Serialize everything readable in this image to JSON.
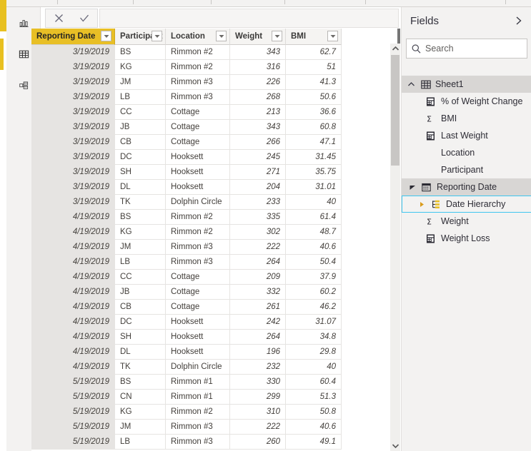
{
  "app": {
    "accent_gold": "#e8bf26",
    "focus_cyan": "#3ec6f0",
    "filler_gray": "#757575"
  },
  "rail": {
    "items": [
      {
        "name": "report-view",
        "icon": "bar-chart-icon",
        "selected": false
      },
      {
        "name": "data-view",
        "icon": "table-icon",
        "selected": true
      },
      {
        "name": "model-view",
        "icon": "relationships-icon",
        "selected": false
      }
    ]
  },
  "formula_bar": {
    "cancel_label": "✕",
    "accept_label": "✓",
    "value": "",
    "placeholder": ""
  },
  "grid": {
    "columns": [
      {
        "label": "Reporting Date",
        "align": "right",
        "selected": true,
        "has_filter": true
      },
      {
        "label": "Participant",
        "align": "left",
        "selected": false,
        "has_filter": true
      },
      {
        "label": "Location",
        "align": "left",
        "selected": false,
        "has_filter": true
      },
      {
        "label": "Weight",
        "align": "right",
        "selected": false,
        "has_filter": true
      },
      {
        "label": "BMI",
        "align": "right",
        "selected": false,
        "has_filter": true
      }
    ],
    "rows": [
      [
        "3/19/2019",
        "BS",
        "Rimmon #2",
        "343",
        "62.7"
      ],
      [
        "3/19/2019",
        "KG",
        "Rimmon #2",
        "316",
        "51"
      ],
      [
        "3/19/2019",
        "JM",
        "Rimmon #3",
        "226",
        "41.3"
      ],
      [
        "3/19/2019",
        "LB",
        "Rimmon #3",
        "268",
        "50.6"
      ],
      [
        "3/19/2019",
        "CC",
        "Cottage",
        "213",
        "36.6"
      ],
      [
        "3/19/2019",
        "JB",
        "Cottage",
        "343",
        "60.8"
      ],
      [
        "3/19/2019",
        "CB",
        "Cottage",
        "266",
        "47.1"
      ],
      [
        "3/19/2019",
        "DC",
        "Hooksett",
        "245",
        "31.45"
      ],
      [
        "3/19/2019",
        "SH",
        "Hooksett",
        "271",
        "35.75"
      ],
      [
        "3/19/2019",
        "DL",
        "Hooksett",
        "204",
        "31.01"
      ],
      [
        "3/19/2019",
        "TK",
        "Dolphin Circle",
        "233",
        "40"
      ],
      [
        "4/19/2019",
        "BS",
        "Rimmon #2",
        "335",
        "61.4"
      ],
      [
        "4/19/2019",
        "KG",
        "Rimmon #2",
        "302",
        "48.7"
      ],
      [
        "4/19/2019",
        "JM",
        "Rimmon #3",
        "222",
        "40.6"
      ],
      [
        "4/19/2019",
        "LB",
        "Rimmon #3",
        "264",
        "50.4"
      ],
      [
        "4/19/2019",
        "CC",
        "Cottage",
        "209",
        "37.9"
      ],
      [
        "4/19/2019",
        "JB",
        "Cottage",
        "332",
        "60.2"
      ],
      [
        "4/19/2019",
        "CB",
        "Cottage",
        "261",
        "46.2"
      ],
      [
        "4/19/2019",
        "DC",
        "Hooksett",
        "242",
        "31.07"
      ],
      [
        "4/19/2019",
        "SH",
        "Hooksett",
        "264",
        "34.8"
      ],
      [
        "4/19/2019",
        "DL",
        "Hooksett",
        "196",
        "29.8"
      ],
      [
        "4/19/2019",
        "TK",
        "Dolphin Circle",
        "232",
        "40"
      ],
      [
        "5/19/2019",
        "BS",
        "Rimmon #1",
        "330",
        "60.4"
      ],
      [
        "5/19/2019",
        "CN",
        "Rimmon #1",
        "299",
        "51.3"
      ],
      [
        "5/19/2019",
        "KG",
        "Rimmon #2",
        "310",
        "50.8"
      ],
      [
        "5/19/2019",
        "JM",
        "Rimmon #3",
        "222",
        "40.6"
      ],
      [
        "5/19/2019",
        "LB",
        "Rimmon #3",
        "260",
        "49.1"
      ]
    ]
  },
  "fields": {
    "title": "Fields",
    "collapse_icon": "chevron-right-icon",
    "search": {
      "placeholder": "Search",
      "value": "",
      "icon": "search-icon"
    },
    "table": {
      "name": "Sheet1",
      "expanded": true,
      "icon": "table-icon"
    },
    "items": [
      {
        "label": "% of Weight Change",
        "icon": "measure-icon",
        "indent": 1,
        "selected": false,
        "expandable": false
      },
      {
        "label": "BMI",
        "icon": "sigma-icon",
        "indent": 1,
        "selected": false,
        "expandable": false
      },
      {
        "label": "Last Weight",
        "icon": "measure-icon",
        "indent": 1,
        "selected": false,
        "expandable": false
      },
      {
        "label": "Location",
        "icon": "none",
        "indent": 1,
        "selected": false,
        "expandable": false
      },
      {
        "label": "Participant",
        "icon": "none",
        "indent": 1,
        "selected": false,
        "expandable": false
      },
      {
        "label": "Reporting Date",
        "icon": "calendar-icon",
        "indent": 1,
        "selected": true,
        "expandable": true,
        "expanded": true
      },
      {
        "label": "Date Hierarchy",
        "icon": "hierarchy-icon",
        "indent": 2,
        "selected": false,
        "focused": true,
        "expandable": true,
        "expanded": false
      },
      {
        "label": "Weight",
        "icon": "sigma-icon",
        "indent": 1,
        "selected": false,
        "expandable": false
      },
      {
        "label": "Weight Loss",
        "icon": "measure-icon",
        "indent": 1,
        "selected": false,
        "expandable": false
      }
    ]
  },
  "scrollbar": {
    "up_arrow": "chevron-up-icon",
    "down_arrow": "chevron-down-icon"
  }
}
